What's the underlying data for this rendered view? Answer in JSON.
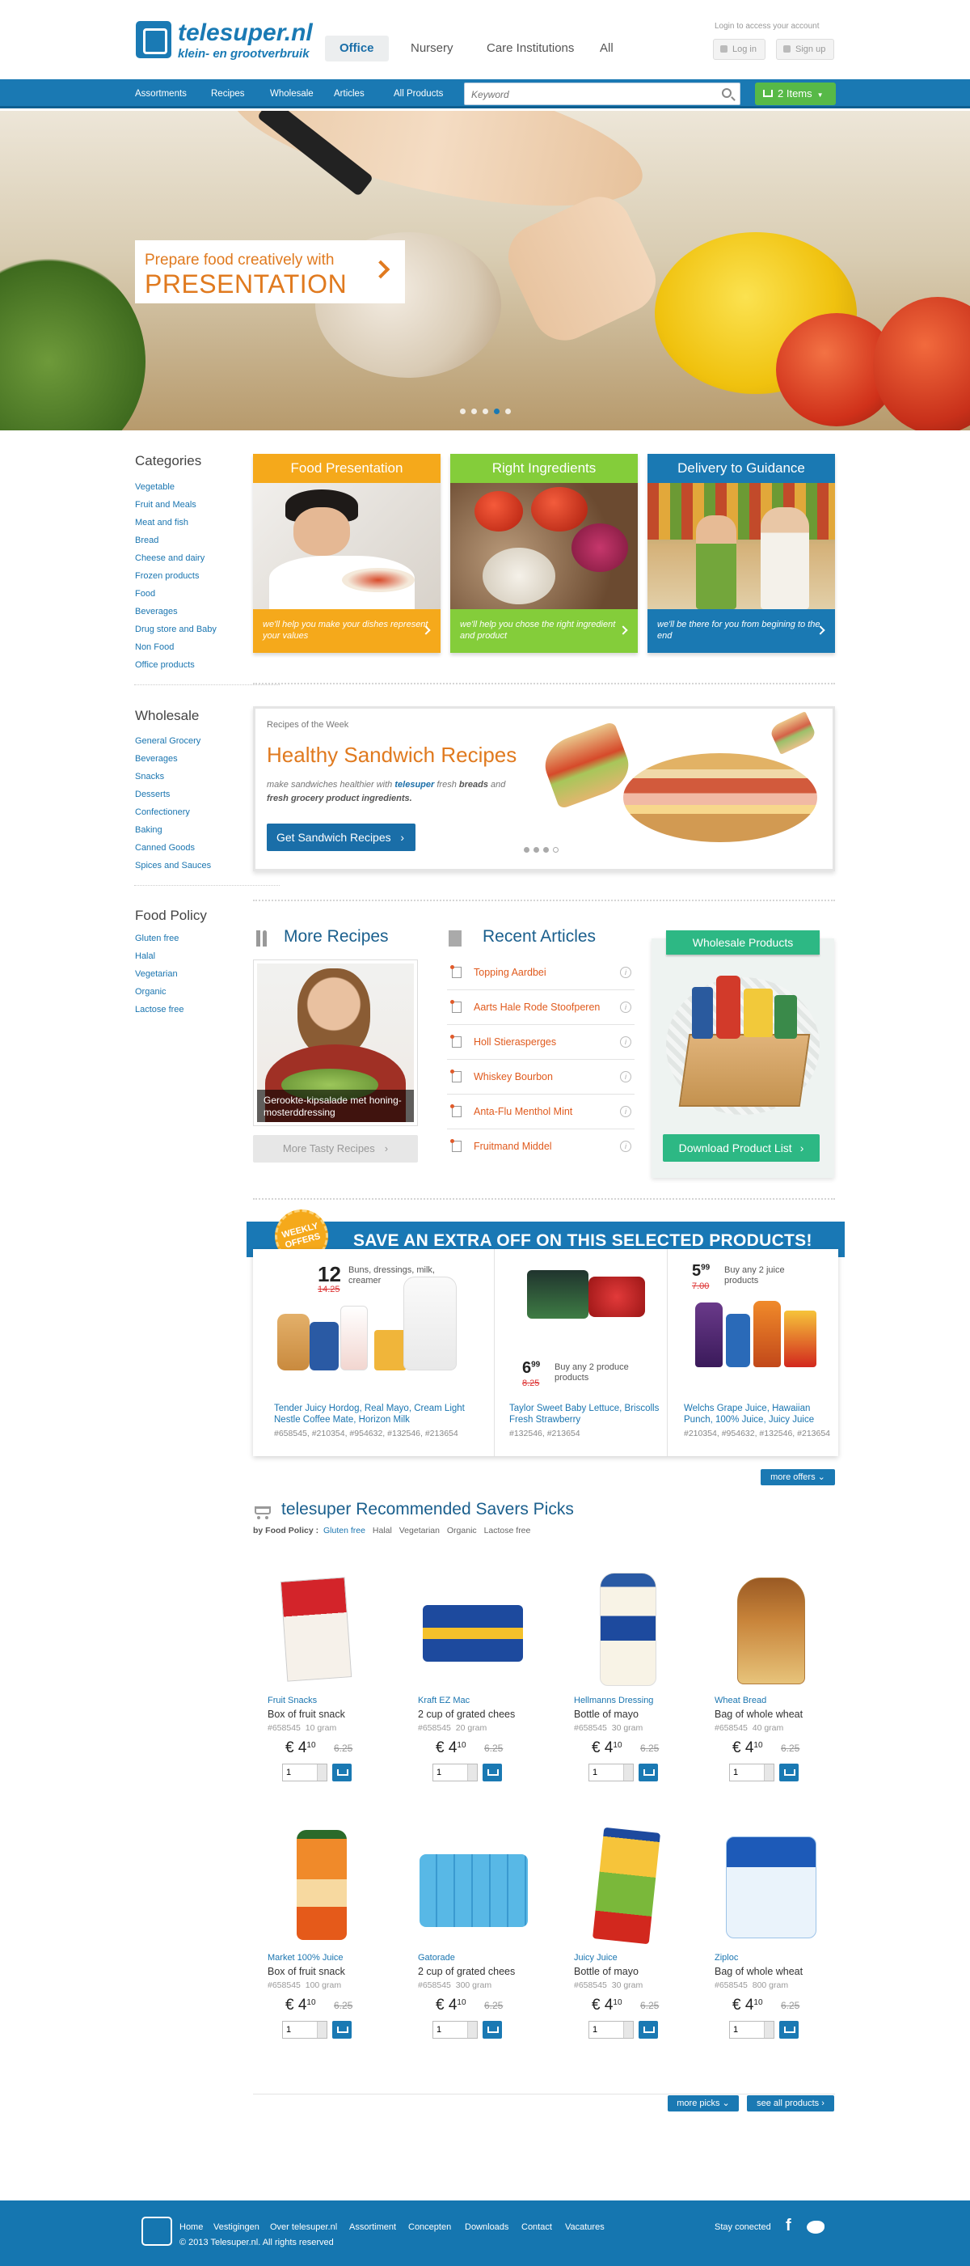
{
  "header": {
    "logo_name": "telesuper.nl",
    "logo_tagline": "klein- en grootverbruik",
    "segments": [
      "Office",
      "Nursery",
      "Care Institutions",
      "All"
    ],
    "login_hint": "Login to access your account",
    "login_label": "Log in",
    "signup_label": "Sign up"
  },
  "nav": {
    "items": [
      "Assortments",
      "Recipes",
      "Wholesale",
      "Articles",
      "All Products"
    ],
    "search_placeholder": "Keyword",
    "cart_label": "2 Items"
  },
  "hero": {
    "caption_line1": "Prepare food creatively with",
    "caption_line2": "PRESENTATION",
    "slide_count": 5,
    "active_slide": 4
  },
  "sidebar": {
    "categories_title": "Categories",
    "categories": [
      "Vegetable",
      "Fruit and Meals",
      "Meat and fish",
      "Bread",
      "Cheese and dairy",
      "Frozen products",
      "Food",
      "Beverages",
      "Drug store and Baby",
      "Non Food",
      "Office products"
    ],
    "wholesale_title": "Wholesale",
    "wholesale": [
      "General Grocery",
      "Beverages",
      "Snacks",
      "Desserts",
      "Confectionery",
      "Baking",
      "Canned Goods",
      "Spices and Sauces"
    ],
    "policy_title": "Food Policy",
    "policy": [
      "Gluten free",
      "Halal",
      "Vegetarian",
      "Organic",
      "Lactose free"
    ]
  },
  "features": [
    {
      "title": "Food Presentation",
      "text": "we'll help you make your dishes represent your values",
      "color": "#f5a91b"
    },
    {
      "title": "Right Ingredients",
      "text": "we'll help you chose the right ingredient and product",
      "color": "#84cd3a"
    },
    {
      "title": "Delivery to Guidance",
      "text": "we'll be there for you from begining to the end",
      "color": "#1a79b3"
    }
  ],
  "recipe_week": {
    "label": "Recipes of the Week",
    "title": "Healthy Sandwich Recipes",
    "desc_1": "make sandwiches healthier with",
    "desc_brand": "telesuper",
    "desc_2": "fresh",
    "desc_3": "breads",
    "desc_4": "and",
    "desc_5": "fresh grocery product ingredients.",
    "button": "Get Sandwich Recipes"
  },
  "more_recipes": {
    "title": "More Recipes",
    "caption": "Gerookte-kipsalade met honing-mosterddressing",
    "button": "More Tasty Recipes"
  },
  "recent_articles": {
    "title": "Recent Articles",
    "items": [
      "Topping Aardbei",
      "Aarts Hale Rode Stoofperen",
      "Holl Stierasperges",
      "Whiskey Bourbon",
      "Anta-Flu Menthol Mint",
      "Fruitmand Middel"
    ]
  },
  "wholesale_products": {
    "ribbon": "Wholesale Products",
    "button": "Download Product List"
  },
  "offers": {
    "badge_line1": "WEEKLY",
    "badge_line2": "OFFERS",
    "title": "SAVE AN EXTRA OFF ON THIS SELECTED PRODUCTS!",
    "items": [
      {
        "price": "12",
        "old": "14.25",
        "desc": "Buns, dressings, milk, creamer",
        "names": "Tender Juicy Hordog, Real Mayo, Cream Light Nestle Coffee Mate, Horizon Milk",
        "codes": "#658545, #210354, #954632, #132546, #213654"
      },
      {
        "price": "6",
        "cents": "99",
        "old": "8.25",
        "desc": "Buy any 2 produce products",
        "names": "Taylor Sweet Baby Lettuce, Briscolls Fresh Strawberry",
        "codes": "#132546, #213654"
      },
      {
        "price": "5",
        "cents": "99",
        "old": "7.00",
        "desc": "Buy any 2 juice products",
        "names": "Welchs Grape Juice, Hawaiian Punch, 100% Juice, Juicy Juice",
        "codes": "#210354, #954632, #132546, #213654"
      }
    ],
    "more_button": "more offers"
  },
  "savers": {
    "title": "telesuper Recommended Savers Picks",
    "filter_label": "by Food Policy :",
    "filters": [
      "Gluten free",
      "Halal",
      "Vegetarian",
      "Organic",
      "Lactose free"
    ],
    "products": [
      {
        "cat": "Fruit Snacks",
        "name": "Box of fruit snack",
        "id": "#658545",
        "size": "10 gram",
        "euro": "€ 4",
        "cents": "10",
        "old": "6.25",
        "qty": "1"
      },
      {
        "cat": "Kraft EZ Mac",
        "name": "2 cup of grated chees",
        "id": "#658545",
        "size": "20 gram",
        "euro": "€ 4",
        "cents": "10",
        "old": "6.25",
        "qty": "1"
      },
      {
        "cat": "Hellmanns Dressing",
        "name": "Bottle of mayo",
        "id": "#658545",
        "size": "30 gram",
        "euro": "€ 4",
        "cents": "10",
        "old": "6.25",
        "qty": "1"
      },
      {
        "cat": "Wheat Bread",
        "name": "Bag of whole wheat",
        "id": "#658545",
        "size": "40 gram",
        "euro": "€ 4",
        "cents": "10",
        "old": "6.25",
        "qty": "1"
      },
      {
        "cat": "Market 100% Juice",
        "name": "Box of fruit snack",
        "id": "#658545",
        "size": "100 gram",
        "euro": "€ 4",
        "cents": "10",
        "old": "6.25",
        "qty": "1"
      },
      {
        "cat": "Gatorade",
        "name": "2 cup of grated chees",
        "id": "#658545",
        "size": "300 gram",
        "euro": "€ 4",
        "cents": "10",
        "old": "6.25",
        "qty": "1"
      },
      {
        "cat": "Juicy Juice",
        "name": "Bottle of mayo",
        "id": "#658545",
        "size": "30 gram",
        "euro": "€ 4",
        "cents": "10",
        "old": "6.25",
        "qty": "1"
      },
      {
        "cat": "Ziploc",
        "name": "Bag of whole wheat",
        "id": "#658545",
        "size": "800 gram",
        "euro": "€ 4",
        "cents": "10",
        "old": "6.25",
        "qty": "1"
      }
    ],
    "more_picks": "more picks",
    "see_all": "see all products"
  },
  "footer": {
    "links": [
      "Home",
      "Vestigingen",
      "Over telesuper.nl",
      "Assortiment",
      "Concepten",
      "Downloads",
      "Contact",
      "Vacatures"
    ],
    "copyright": "© 2013 Telesuper.nl. All rights reserved",
    "stay": "Stay conected"
  },
  "colors": {
    "brand": "#1a79b3",
    "orange": "#e07a1f",
    "green": "#57b947",
    "yellow": "#f5a91b"
  }
}
